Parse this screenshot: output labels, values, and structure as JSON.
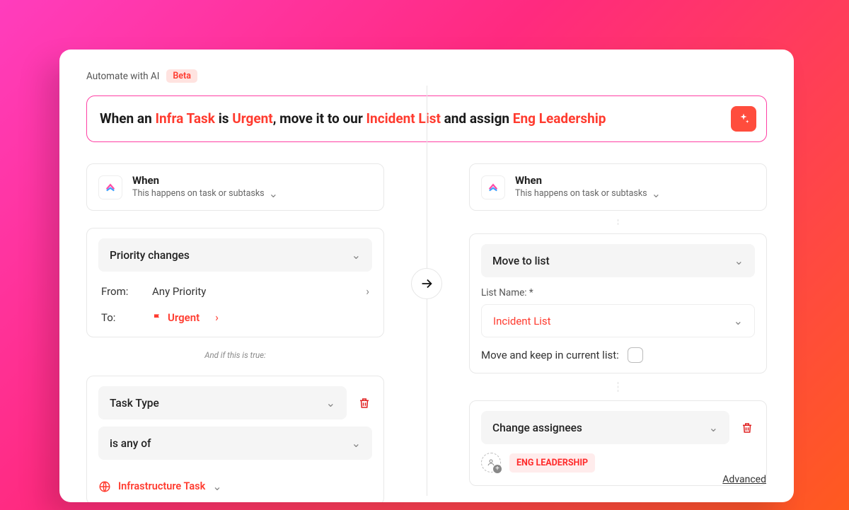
{
  "header": {
    "label": "Automate with AI",
    "beta": "Beta"
  },
  "prompt": {
    "prefix1": "When an ",
    "hl1": "Infra Task",
    "mid1": " is ",
    "hl2": "Urgent",
    "mid2": ", move it to our ",
    "hl3": "Incident List",
    "mid3": " and assign ",
    "hl4": "Eng Leadership"
  },
  "left": {
    "when_title": "When",
    "when_sub": "This happens on task or subtasks",
    "trigger": "Priority changes",
    "from_label": "From:",
    "from_value": "Any Priority",
    "to_label": "To:",
    "to_value": "Urgent",
    "and_if": "And if this is true:",
    "filter_field": "Task Type",
    "filter_op": "is any of",
    "filter_value": "Infrastructure Task"
  },
  "right": {
    "when_title": "When",
    "when_sub": "This happens on task or subtasks",
    "action1": "Move to list",
    "list_label": "List Name: *",
    "list_value": "Incident List",
    "keep_label": "Move and keep in current list:",
    "action2": "Change assignees",
    "assignee": "ENG LEADERSHIP",
    "advanced": "Advanced"
  }
}
